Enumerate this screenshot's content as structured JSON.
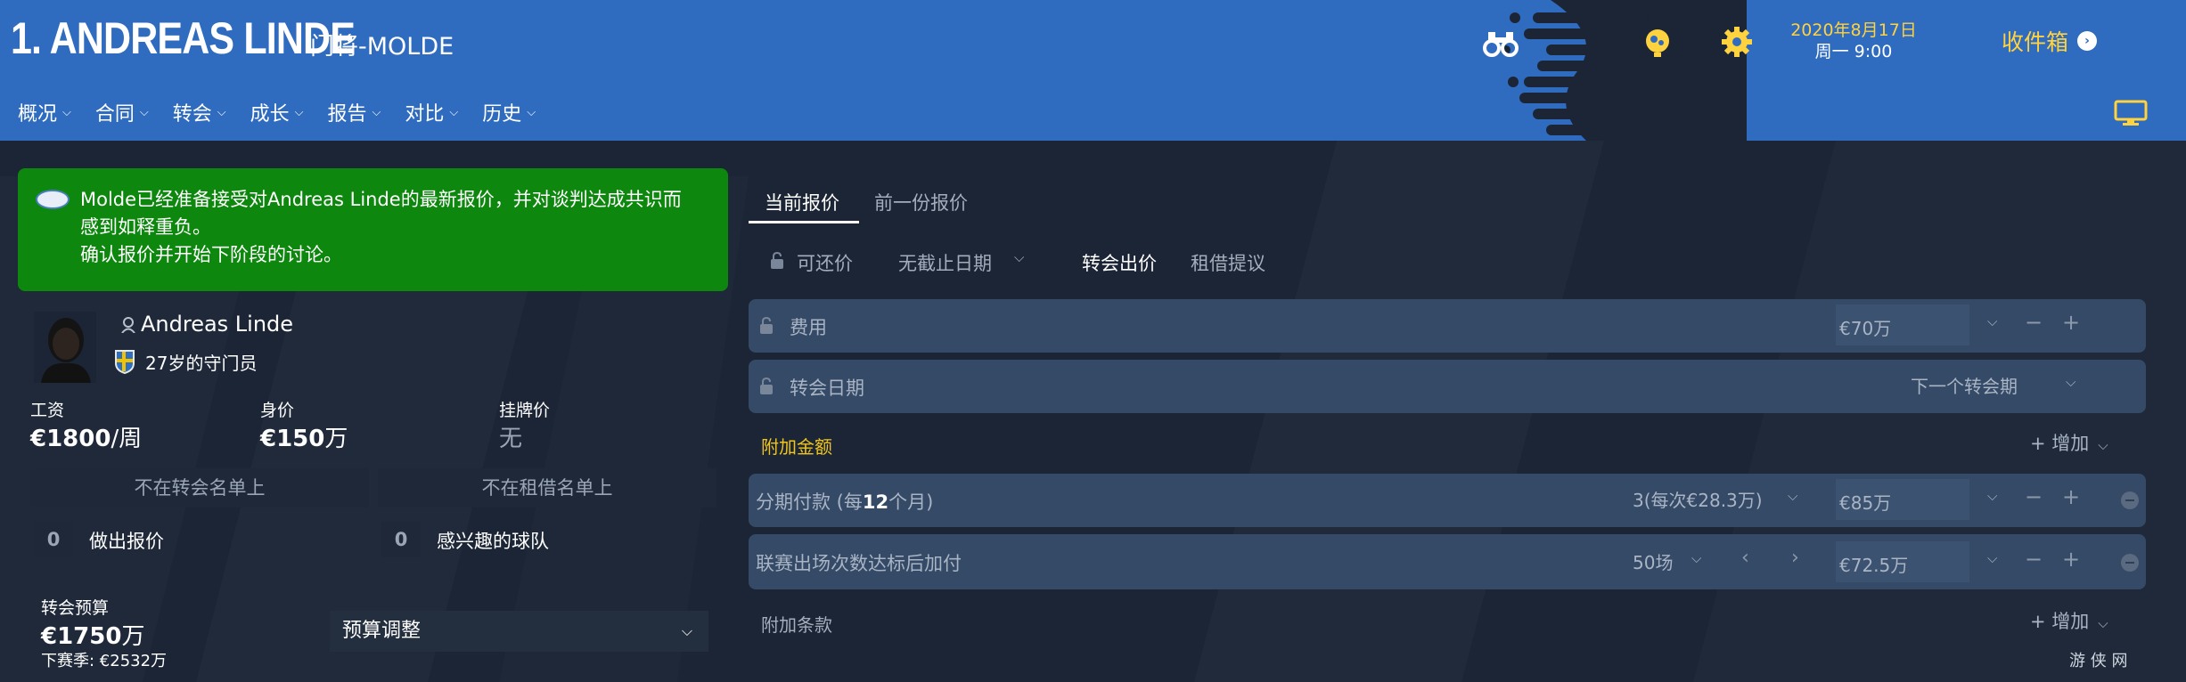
{
  "header": {
    "title": "1. ANDREAS LINDE",
    "subtitle": "门将-MOLDE",
    "date": "2020年8月17日",
    "time": "周一 9:00",
    "inbox_label": "收件箱",
    "nav": [
      "概况",
      "合同",
      "转会",
      "成长",
      "报告",
      "对比",
      "历史"
    ],
    "icons": [
      "binoculars-icon",
      "football-icon",
      "gear-icon",
      "screen-icon"
    ],
    "accent_color": "#2f6bbf",
    "highlight_color": "#ffd23f"
  },
  "notice": {
    "line1": "Molde已经准备接受对Andreas Linde的最新报价，并对谈判达成共识而",
    "line2": "感到如释重负。",
    "line3": "确认报价并开始下阶段的讨论。",
    "color": "#0d870d"
  },
  "player": {
    "name": "Andreas Linde",
    "desc": "27岁的守门员",
    "wage_label": "工资",
    "wage_value": "€1800",
    "wage_unit": "/周",
    "value_label": "身价",
    "value_value": "€150",
    "value_unit": "万",
    "asking_label": "挂牌价",
    "asking_value": "无",
    "transfer_status": "不在转会名单上",
    "loan_status": "不在租借名单上",
    "offers_count": "0",
    "offers_label": "做出报价",
    "teams_count": "0",
    "teams_label": "感兴趣的球队"
  },
  "budget": {
    "label": "转会预算",
    "value": "€1750",
    "unit": "万",
    "next_season": "下赛季: €2532万",
    "adjust_label": "预算调整"
  },
  "offer": {
    "tab_current": "当前报价",
    "tab_previous": "前一份报价",
    "negotiable": "可还价",
    "deadline": "无截止日期",
    "transfer_offer": "转会出价",
    "loan_offer": "租借提议",
    "fee_label": "费用",
    "fee_value": "€70万",
    "date_label": "转会日期",
    "date_value": "下一个转会期",
    "addons_label": "附加金额",
    "add_label": "增加",
    "installments_label_a": "分期付款 (每",
    "installments_label_b": "12",
    "installments_label_c": "个月)",
    "installments_count": "3(每次€28.3万)",
    "installments_value": "€85万",
    "appearances_label": "联赛出场次数达标后加付",
    "appearances_count": "50场",
    "appearances_value": "€72.5万",
    "clauses_label": "附加条款",
    "add_label_2": "增加"
  },
  "watermark": "游 侠 网"
}
